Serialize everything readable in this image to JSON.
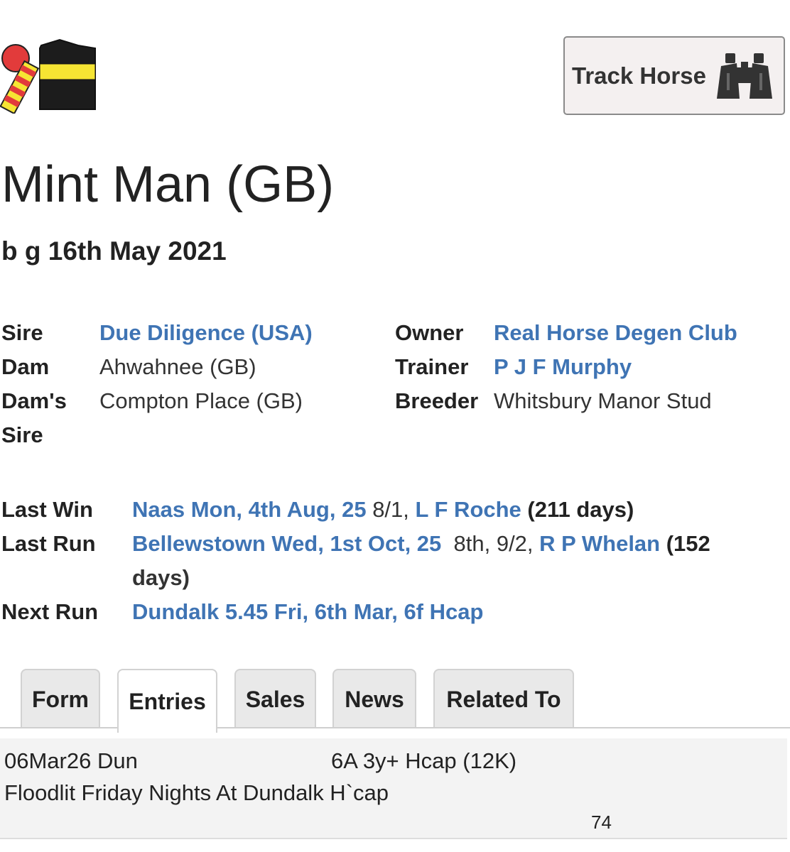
{
  "header": {
    "track_button_label": "Track Horse"
  },
  "horse": {
    "name": "Mint Man (GB)",
    "description": "b g 16th May 2021"
  },
  "pedigree": {
    "sire_label": "Sire",
    "sire_value": "Due Diligence (USA)",
    "dam_label": "Dam",
    "dam_value": "Ahwahnee (GB)",
    "dams_sire_label_line1": "Dam's",
    "dams_sire_label_line2": "Sire",
    "dams_sire_value": "Compton Place (GB)"
  },
  "connections": {
    "owner_label": "Owner",
    "owner_value": "Real Horse Degen Club",
    "trainer_label": "Trainer",
    "trainer_value": "P J F Murphy",
    "breeder_label": "Breeder",
    "breeder_value": "Whitsbury Manor Stud"
  },
  "runs": {
    "last_win_label": "Last Win",
    "last_win_race": "Naas Mon, 4th Aug, 25",
    "last_win_odds": " 8/1, ",
    "last_win_jockey": "L F Roche",
    "last_win_days": " (211 days)",
    "last_run_label": "Last Run",
    "last_run_race": "Bellewstown Wed, 1st Oct, 25",
    "last_run_result": "  8th, 9/2, ",
    "last_run_jockey": "R P Whelan",
    "last_run_days_part1": " (152",
    "last_run_days_part2": "days)",
    "next_run_label": "Next Run",
    "next_run_race": "Dundalk 5.45 Fri, 6th Mar, 6f Hcap"
  },
  "tabs": [
    {
      "label": "Form",
      "active": false
    },
    {
      "label": "Entries",
      "active": true
    },
    {
      "label": "Sales",
      "active": false
    },
    {
      "label": "News",
      "active": false
    },
    {
      "label": "Related To",
      "active": false
    }
  ],
  "entry": {
    "date_course": "06Mar26 Dun",
    "race_class": "6A 3y+ Hcap (12K)",
    "race_name": "Floodlit Friday Nights At Dundalk H`cap",
    "rating": "74"
  },
  "colors": {
    "link": "#3f74b4",
    "silks_body": "#1c1c1c",
    "silks_stripe": "#f6e533",
    "silks_cap": "#e23b3b",
    "tab_bg": "#e9e9e9"
  },
  "icons": {
    "silks": "jockey-silks-icon",
    "binoculars": "binoculars-icon"
  }
}
